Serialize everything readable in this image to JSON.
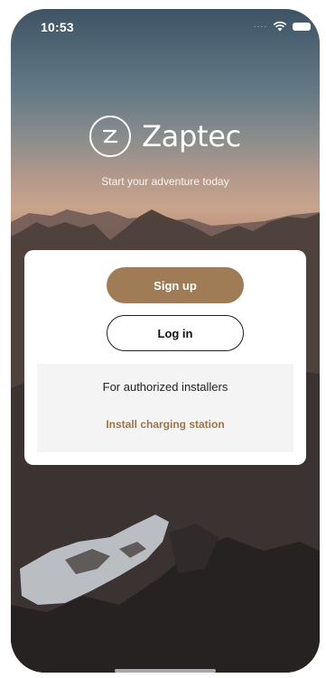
{
  "status_bar": {
    "time": "10:53",
    "signal_dots": "....",
    "icons": [
      "wifi-icon",
      "battery-icon"
    ]
  },
  "brand": {
    "logo_letter": "Z",
    "name": "Zaptec"
  },
  "tagline": "Start your adventure today",
  "actions": {
    "sign_up_label": "Sign up",
    "log_in_label": "Log in"
  },
  "installers": {
    "label": "For authorized installers",
    "link_label": "Install charging station"
  },
  "colors": {
    "accent": "#9f7c56",
    "link": "#9c7549",
    "card_bg": "#ffffff",
    "installer_bg": "#f4f4f4"
  }
}
